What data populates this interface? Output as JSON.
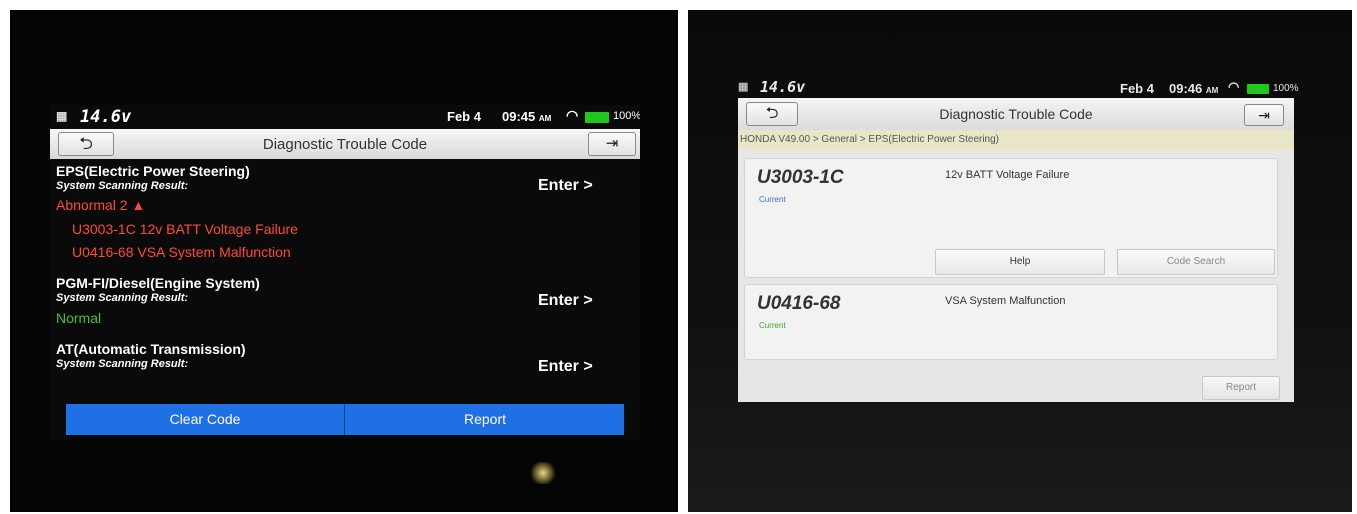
{
  "left_device": {
    "status": {
      "voltage": "14.6v",
      "date": "Feb 4",
      "time": "09:45",
      "time_suffix": "AM",
      "battery": "100%"
    },
    "title": "Diagnostic Trouble Code",
    "systems": [
      {
        "name": "EPS(Electric Power Steering)",
        "subtitle": "System Scanning Result:",
        "result": "Abnormal 2",
        "codes": [
          "U3003-1C 12v BATT Voltage Failure",
          "U0416-68 VSA System Malfunction"
        ],
        "enter": "Enter >"
      },
      {
        "name": "PGM-FI/Diesel(Engine System)",
        "subtitle": "System Scanning Result:",
        "result": "Normal",
        "enter": "Enter >"
      },
      {
        "name": "AT(Automatic Transmission)",
        "subtitle": "System Scanning Result:",
        "enter": "Enter >"
      }
    ],
    "bottom": {
      "clear": "Clear Code",
      "report": "Report"
    },
    "colors": {
      "abnormal": "#ff4a30",
      "normal": "#3fc13f",
      "button_bar": "#1f6fe5"
    }
  },
  "right_device": {
    "status": {
      "voltage": "14.6v",
      "date": "Feb 4",
      "time": "09:46",
      "time_suffix": "AM",
      "battery": "100%"
    },
    "title": "Diagnostic Trouble Code",
    "breadcrumb": "HONDA V49.00 > General > EPS(Electric Power Steering)",
    "dtcs": [
      {
        "code": "U3003-1C",
        "status": "Current",
        "description": "12v BATT Voltage Failure"
      },
      {
        "code": "U0416-68",
        "status": "Current",
        "description": "VSA System Malfunction"
      }
    ],
    "buttons": {
      "help": "Help",
      "code_search": "Code Search",
      "report": "Report"
    }
  }
}
